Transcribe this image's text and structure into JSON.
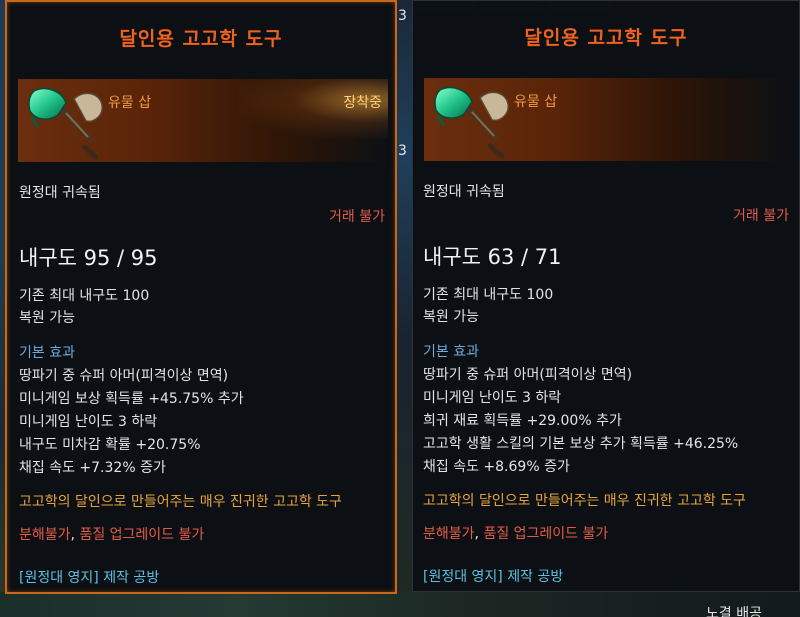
{
  "background": {
    "left_partial": "3",
    "mid_partial": "3",
    "bottom_right_partial": "노결 배공"
  },
  "left_tooltip": {
    "title": "달인용 고고학 도구",
    "item_type": "유물 삽",
    "equipped_label": "장착중",
    "binding": "원정대 귀속됨",
    "trade": "거래 불가",
    "durability": "내구도 95 / 95",
    "max_durability": "기존 최대 내구도 100",
    "repair": "복원 가능",
    "basic_effect_label": "기본 효과",
    "effects": [
      "땅파기 중 슈퍼 아머(피격이상 면역)",
      "미니게임 보상 획득률 +45.75% 추가",
      "미니게임 난이도 3 하락",
      "내구도 미차감 확률 +20.75%",
      "채집 속도 +7.32% 증가"
    ],
    "description": "고고학의 달인으로 만들어주는 매우 진귀한 고고학 도구",
    "restriction_part1": "분해불가",
    "restriction_sep": ", ",
    "restriction_part2": "품질 업그레이드 불가",
    "source": "[원정대 영지] 제작 공방"
  },
  "right_tooltip": {
    "title": "달인용 고고학 도구",
    "item_type": "유물 삽",
    "binding": "원정대 귀속됨",
    "trade": "거래 불가",
    "durability": "내구도 63 / 71",
    "max_durability": "기존 최대 내구도 100",
    "repair": "복원 가능",
    "basic_effect_label": "기본 효과",
    "effects": [
      "땅파기 중 슈퍼 아머(피격이상 면역)",
      "미니게임 난이도 3 하락",
      "희귀 재료 획득률 +29.00% 추가",
      "고고학 생활 스킬의 기본 보상 추가 획득률 +46.25%",
      "채집 속도 +8.69% 증가"
    ],
    "description": "고고학의 달인으로 만들어주는 매우 진귀한 고고학 도구",
    "restriction_part1": "분해불가",
    "restriction_sep": ", ",
    "restriction_part2": "품질 업그레이드 불가",
    "source": "[원정대 영지] 제작 공방"
  }
}
